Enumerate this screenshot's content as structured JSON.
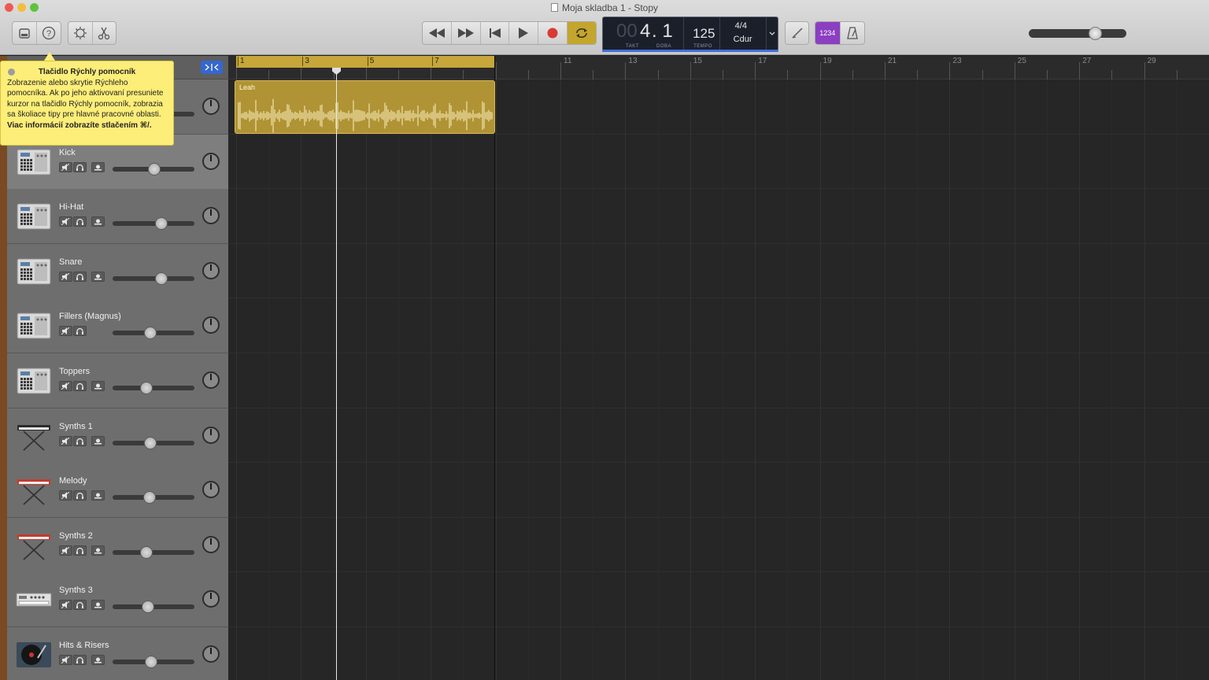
{
  "window": {
    "title": "Moja skladba 1 - Stopy"
  },
  "toolbar": {
    "lcd": {
      "bar_dim": "00",
      "bar": "4",
      "beat": ". 1",
      "takt_label": "TAKT",
      "doba_label": "DOBA",
      "tempo": "125",
      "tempo_label": "TEMPO",
      "time_signature": "4/4",
      "key": "Cdur"
    },
    "count_in_label": "1234",
    "icons": {
      "library": "library-icon",
      "quick_help": "help-icon",
      "smart_controls": "smart-controls-icon",
      "editors": "scissors-icon",
      "rewind": "rewind-icon",
      "forward": "fast-forward-icon",
      "to_start": "go-to-start-icon",
      "play": "play-icon",
      "record": "record-icon",
      "cycle": "cycle-icon",
      "tuner": "tuner-icon",
      "metronome": "metronome-icon"
    },
    "colors": {
      "record": "#d83b33",
      "cycle_active": "#c4a52e",
      "count_in_active": "#8b3fc1",
      "lcd_bg": "#1b1f2a"
    },
    "master_volume": 0.7
  },
  "tooltip": {
    "title": "Tlačidlo Rýchly pomocník",
    "body": "Zobrazenie alebo skrytie Rýchleho pomocníka. Ak po jeho aktivovaní presuniete kurzor na tlačidlo Rýchly pomocník, zobrazia sa školiace tipy pre hlavné pracovné oblasti.",
    "footer": "Viac informácií zobrazíte stlačením ⌘/."
  },
  "ruler": {
    "cycle_labels": [
      "1",
      "3",
      "5",
      "7"
    ],
    "labels": [
      "11",
      "13",
      "15",
      "17",
      "19",
      "21",
      "23",
      "25",
      "27",
      "29"
    ],
    "cycle_color": "#c7a63a"
  },
  "region": {
    "name": "Leah",
    "color": "#b09334"
  },
  "tracks": [
    {
      "name": "",
      "instrument": "drum-machine-icon",
      "volume": 0.6,
      "has_record": true
    },
    {
      "name": "Kick",
      "instrument": "drum-machine-icon",
      "volume": 0.6,
      "has_record": true
    },
    {
      "name": "Hi-Hat",
      "instrument": "drum-machine-icon",
      "volume": 0.71,
      "has_record": true
    },
    {
      "name": "Snare",
      "instrument": "drum-machine-icon",
      "volume": 0.71,
      "has_record": true
    },
    {
      "name": "Fillers (Magnus)",
      "instrument": "drum-machine-icon",
      "volume": 0.55,
      "has_record": false
    },
    {
      "name": "Toppers",
      "instrument": "drum-machine-icon",
      "volume": 0.49,
      "has_record": true
    },
    {
      "name": "Synths 1",
      "instrument": "keyboard-stand-icon",
      "volume": 0.55,
      "has_record": true
    },
    {
      "name": "Melody",
      "instrument": "red-keyboard-icon",
      "volume": 0.53,
      "has_record": true
    },
    {
      "name": "Synths 2",
      "instrument": "red-keyboard-icon",
      "volume": 0.49,
      "has_record": true
    },
    {
      "name": "Synths 3",
      "instrument": "rack-synth-icon",
      "volume": 0.51,
      "has_record": true
    },
    {
      "name": "Hits & Risers",
      "instrument": "turntable-icon",
      "volume": 0.56,
      "has_record": true
    }
  ]
}
